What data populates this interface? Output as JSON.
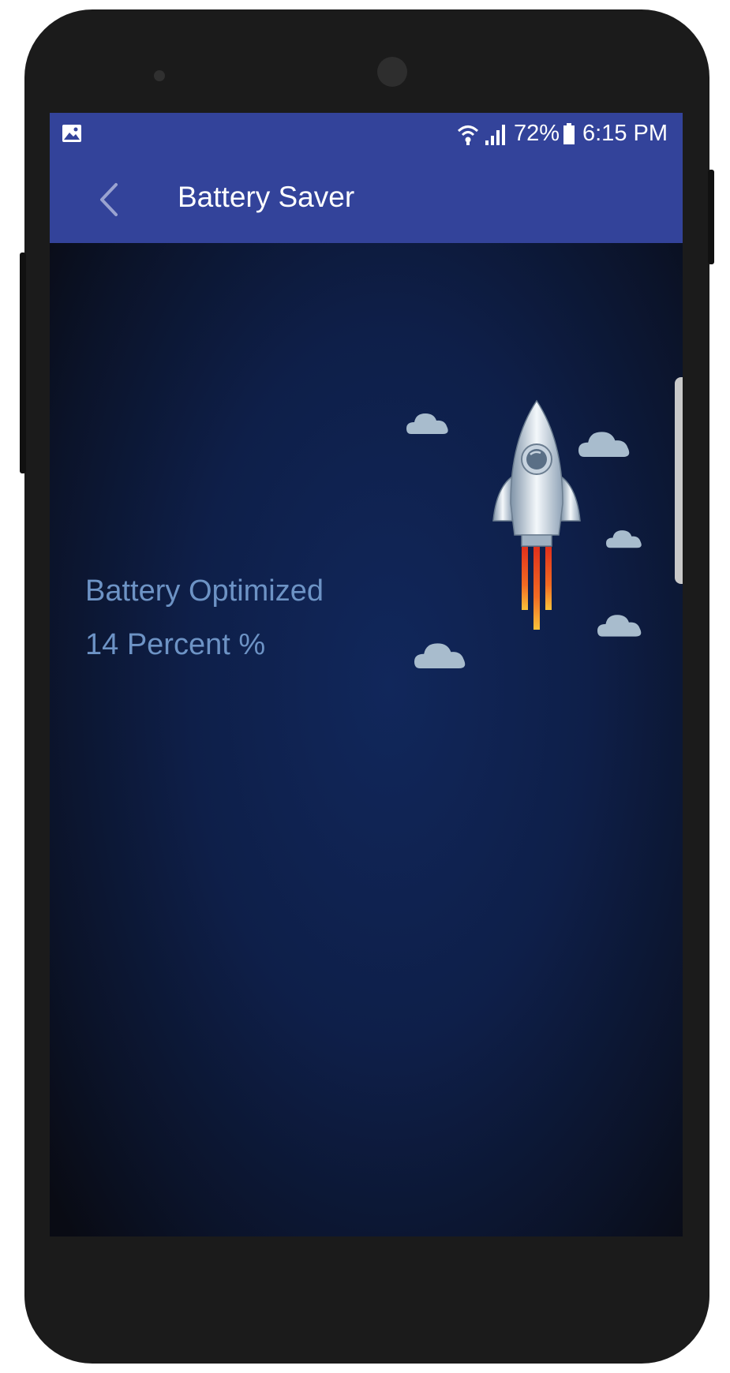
{
  "status_bar": {
    "notification_icon": "image-icon",
    "wifi_icon": "wifi-icon",
    "signal_icon": "signal-icon",
    "battery_percent": "72%",
    "battery_icon": "battery-icon",
    "time": "6:15 PM"
  },
  "toolbar": {
    "back_icon": "chevron-left-icon",
    "title": "Battery Saver"
  },
  "main": {
    "status_label": "Battery Optimized",
    "percent_label": "14 Percent %",
    "illustration": "rocket-icon",
    "decoration": "cloud-icon"
  },
  "colors": {
    "app_bar": "#33439a",
    "text_accent": "#6d93c5",
    "background": "#0e1f49"
  }
}
